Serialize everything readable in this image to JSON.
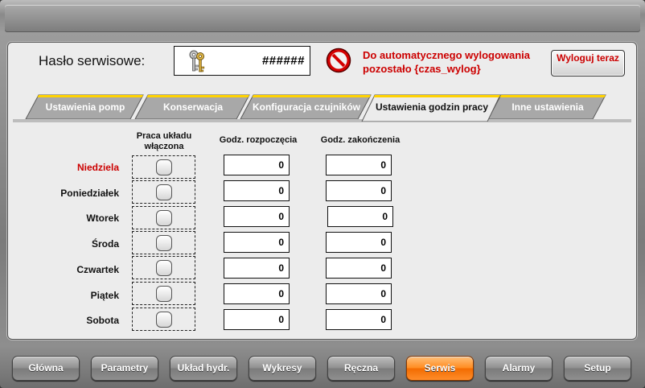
{
  "service": {
    "password_label": "Hasło serwisowe:",
    "password_value": "######",
    "logout_message": "Do automatycznego wylogowania pozostało {czas_wylog}",
    "logout_button": "Wyloguj teraz"
  },
  "tabs": [
    {
      "label": "Ustawienia pomp",
      "active": false
    },
    {
      "label": "Konserwacja",
      "active": false
    },
    {
      "label": "Konfiguracja czujników",
      "active": false
    },
    {
      "label": "Ustawienia godzin pracy",
      "active": true
    },
    {
      "label": "Inne ustawienia",
      "active": false
    }
  ],
  "schedule": {
    "col_enabled": "Praca układu włączona",
    "col_start": "Godz. rozpoczęcia",
    "col_end": "Godz. zakończenia",
    "days": [
      {
        "name": "Niedziela",
        "highlight": true,
        "enabled": false,
        "start": "0",
        "end": "0"
      },
      {
        "name": "Poniedziałek",
        "highlight": false,
        "enabled": false,
        "start": "0",
        "end": "0"
      },
      {
        "name": "Wtorek",
        "highlight": false,
        "enabled": false,
        "start": "0",
        "end": "0"
      },
      {
        "name": "Środa",
        "highlight": false,
        "enabled": false,
        "start": "0",
        "end": "0"
      },
      {
        "name": "Czwartek",
        "highlight": false,
        "enabled": false,
        "start": "0",
        "end": "0"
      },
      {
        "name": "Piątek",
        "highlight": false,
        "enabled": false,
        "start": "0",
        "end": "0"
      },
      {
        "name": "Sobota",
        "highlight": false,
        "enabled": false,
        "start": "0",
        "end": "0"
      }
    ]
  },
  "nav": [
    {
      "label": "Główna",
      "active": false
    },
    {
      "label": "Parametry",
      "active": false
    },
    {
      "label": "Układ hydr.",
      "active": false
    },
    {
      "label": "Wykresy",
      "active": false
    },
    {
      "label": "Ręczna",
      "active": false
    },
    {
      "label": "Serwis",
      "active": true
    },
    {
      "label": "Alarmy",
      "active": false
    },
    {
      "label": "Setup",
      "active": false
    }
  ],
  "colors": {
    "accent_red": "#cc0000",
    "active_orange": "#ff8a1e",
    "tab_yellow": "#ffd200"
  },
  "icons": {
    "password": "keys-icon",
    "logout_warning": "stop-icon"
  }
}
